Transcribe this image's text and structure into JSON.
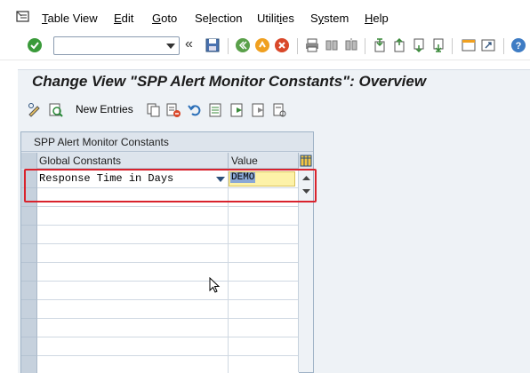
{
  "menubar": {
    "items": [
      {
        "pre": "",
        "mnemonic": "T",
        "post": "able View"
      },
      {
        "pre": "",
        "mnemonic": "E",
        "post": "dit"
      },
      {
        "pre": "",
        "mnemonic": "G",
        "post": "oto"
      },
      {
        "pre": "Se",
        "mnemonic": "l",
        "post": "ection"
      },
      {
        "pre": "Utilit",
        "mnemonic": "i",
        "post": "es"
      },
      {
        "pre": "S",
        "mnemonic": "y",
        "post": "stem"
      },
      {
        "pre": "",
        "mnemonic": "H",
        "post": "elp"
      }
    ]
  },
  "toolbar": {
    "command_field_value": "",
    "chevron": "«"
  },
  "screen": {
    "title": "Change View \"SPP Alert Monitor Constants\": Overview"
  },
  "app_toolbar": {
    "new_entries_label": "New Entries"
  },
  "table": {
    "title": "SPP Alert Monitor Constants",
    "columns": [
      "Global Constants",
      "Value"
    ],
    "rows": [
      {
        "constant": "Response Time in Days",
        "value": "DEMO"
      }
    ],
    "empty_rows": 10
  },
  "colors": {
    "highlight_border": "#d9232d",
    "value_field_bg": "#fdf2a8",
    "selected_text_bg": "#8aa8d6",
    "title_bg": "#eef2f6"
  }
}
